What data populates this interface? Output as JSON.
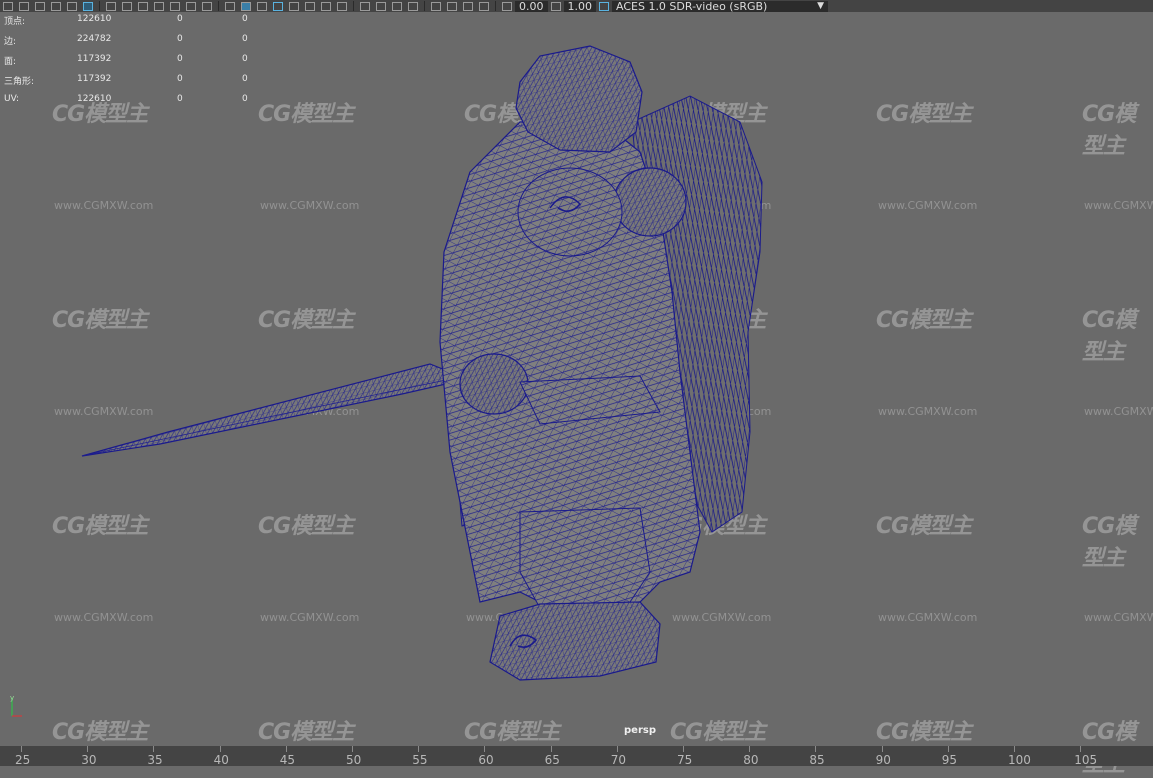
{
  "toolbar": {
    "exposure_value": "0.00",
    "gamma_value": "1.00",
    "color_transform": "ACES 1.0 SDR-video (sRGB)"
  },
  "stats": [
    {
      "label": "顶点:",
      "v1": "122610",
      "v2": "0",
      "v3": "0"
    },
    {
      "label": "边:",
      "v1": "224782",
      "v2": "0",
      "v3": "0"
    },
    {
      "label": "面:",
      "v1": "117392",
      "v2": "0",
      "v3": "0"
    },
    {
      "label": "三角形:",
      "v1": "117392",
      "v2": "0",
      "v3": "0"
    },
    {
      "label": "UV:",
      "v1": "122610",
      "v2": "0",
      "v3": "0"
    }
  ],
  "viewport": {
    "camera_name": "persp",
    "watermark_url": "www.CGMXW.com",
    "watermark_logo": "CG模型主"
  },
  "timeline": {
    "ticks": [
      "25",
      "30",
      "35",
      "40",
      "45",
      "50",
      "55",
      "60",
      "65",
      "70",
      "75",
      "80",
      "85",
      "90",
      "95",
      "100",
      "105"
    ]
  },
  "colors": {
    "viewport_bg": "#6a6a6a",
    "wireframe": "#1a1a8c",
    "mesh_fill": "#808080"
  }
}
